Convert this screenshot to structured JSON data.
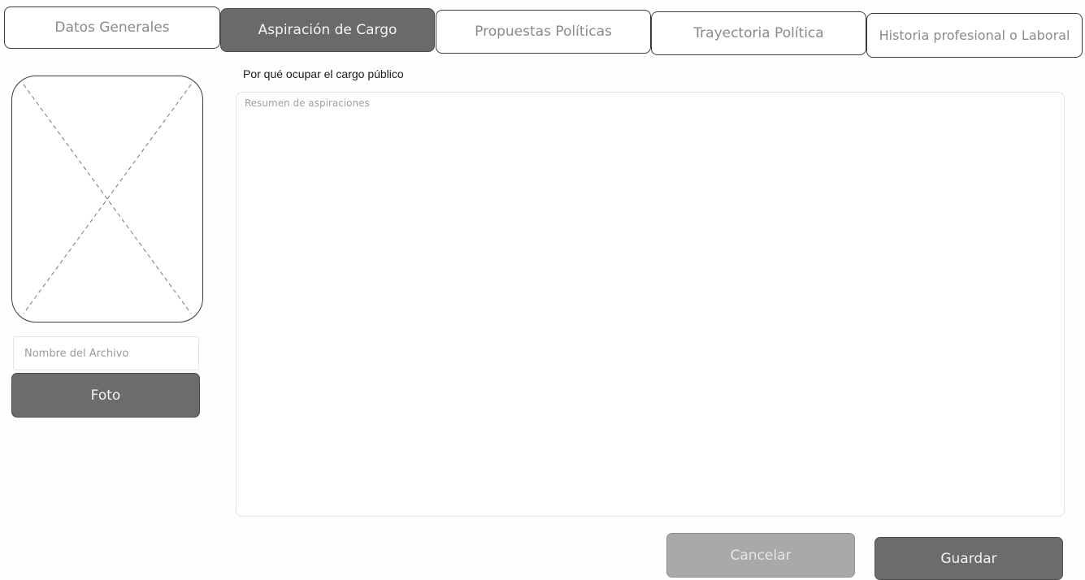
{
  "tabs": [
    {
      "label": "Datos Generales",
      "active": false
    },
    {
      "label": "Aspiración de Cargo",
      "active": true
    },
    {
      "label": "Propuestas Políticas",
      "active": false
    },
    {
      "label": "Trayectoria Política",
      "active": false
    },
    {
      "label": "Historia profesional o Laboral",
      "active": false
    }
  ],
  "photo": {
    "placeholder_icon": "image-placeholder-icon",
    "file_name_placeholder": "Nombre del Archivo",
    "button_label": "Foto"
  },
  "aspiration": {
    "label": "Por qué ocupar el cargo público",
    "placeholder": "Resumen de aspiraciones"
  },
  "actions": {
    "cancel_label": "Cancelar",
    "save_label": "Guardar"
  },
  "colors": {
    "active_tab": "#6a6a6a",
    "primary_button": "#6c6c6c",
    "secondary_button": "#a9a9a9"
  }
}
